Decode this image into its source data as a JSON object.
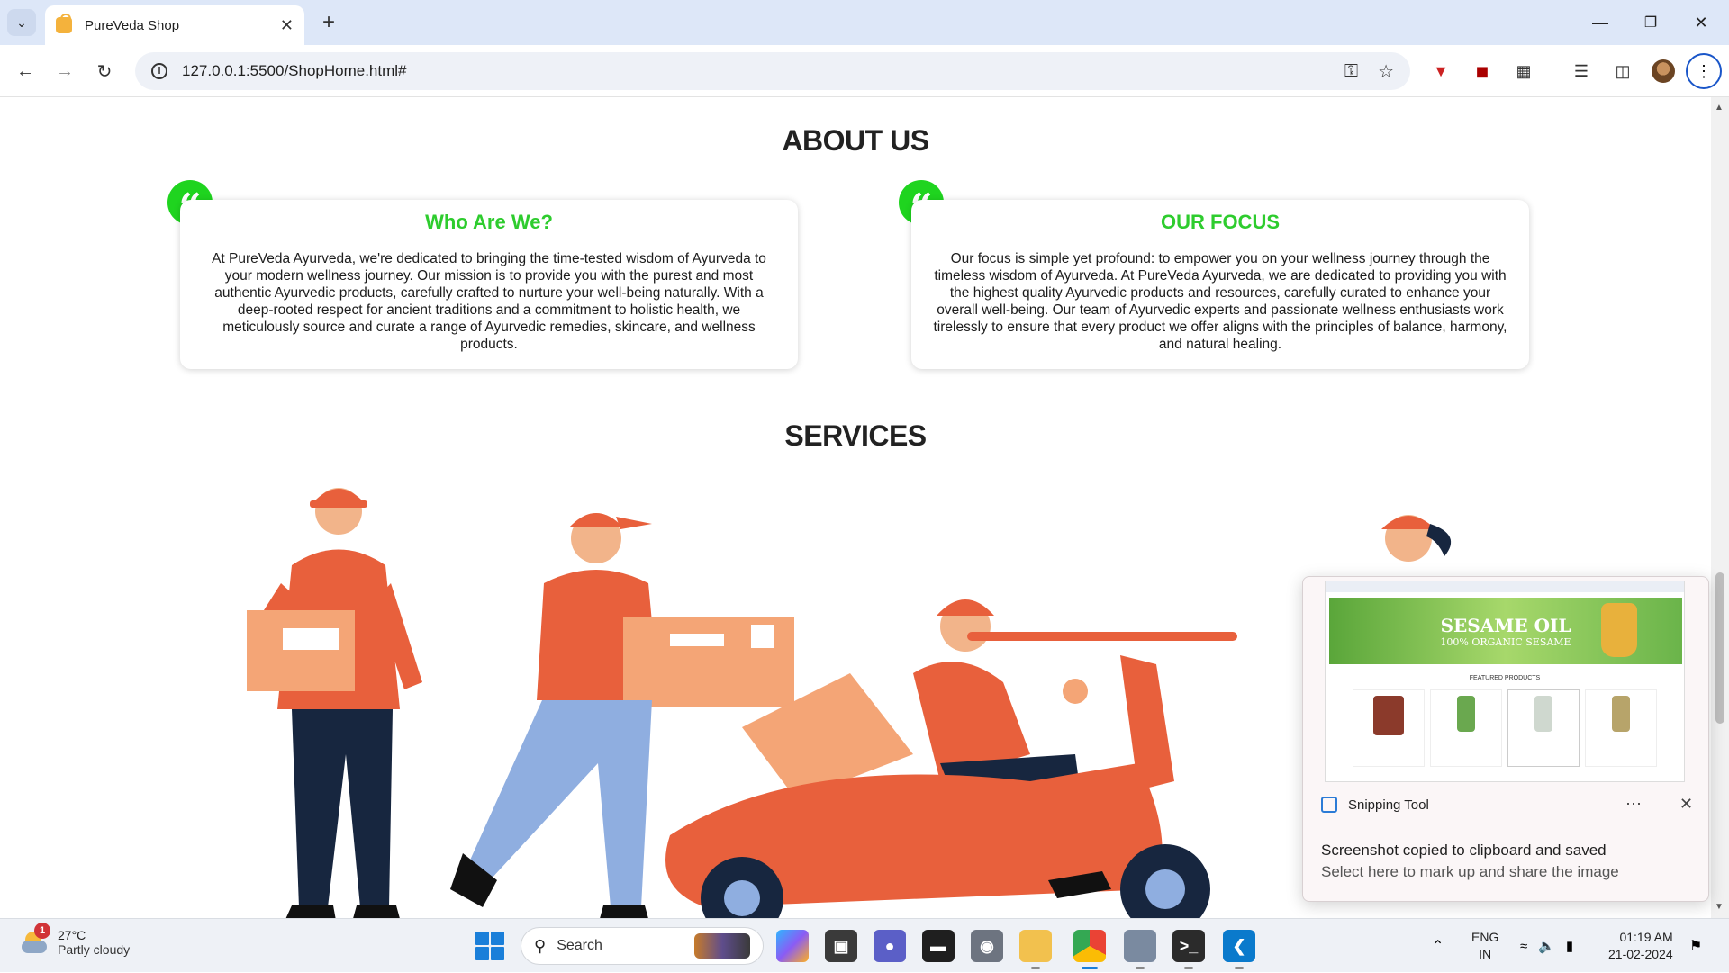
{
  "browser": {
    "tab_title": "PureVeda Shop",
    "url": "127.0.0.1:5500/ShopHome.html#"
  },
  "page": {
    "about_heading": "ABOUT US",
    "cards": [
      {
        "title": "Who Are We?",
        "text": "At PureVeda Ayurveda, we're dedicated to bringing the time-tested wisdom of Ayurveda to your modern wellness journey. Our mission is to provide you with the purest and most authentic Ayurvedic products, carefully crafted to nurture your well-being naturally. With a deep-rooted respect for ancient traditions and a commitment to holistic health, we meticulously source and curate a range of Ayurvedic remedies, skincare, and wellness products."
      },
      {
        "title": "OUR FOCUS",
        "text": "Our focus is simple yet profound: to empower you on your wellness journey through the timeless wisdom of Ayurveda. At PureVeda Ayurveda, we are dedicated to providing you with the highest quality Ayurvedic products and resources, carefully curated to enhance your overall well-being. Our team of Ayurvedic experts and passionate wellness enthusiasts work tirelessly to ensure that every product we offer aligns with the principles of balance, harmony, and natural healing."
      }
    ],
    "services_heading": "SERVICES",
    "accent_color": "#2ecc2e"
  },
  "toast": {
    "app_name": "Snipping Tool",
    "title": "Screenshot copied to clipboard and saved",
    "subtitle": "Select here to mark up and share the image",
    "preview": {
      "banner_title": "SESAME OIL",
      "banner_sub": "100% ORGANIC SESAME",
      "section": "FEATURED PRODUCTS"
    }
  },
  "taskbar": {
    "weather_temp": "27°C",
    "weather_desc": "Partly cloudy",
    "weather_badge": "1",
    "search_placeholder": "Search",
    "lang_line1": "ENG",
    "lang_line2": "IN",
    "time": "01:19 AM",
    "date": "21-02-2024"
  }
}
